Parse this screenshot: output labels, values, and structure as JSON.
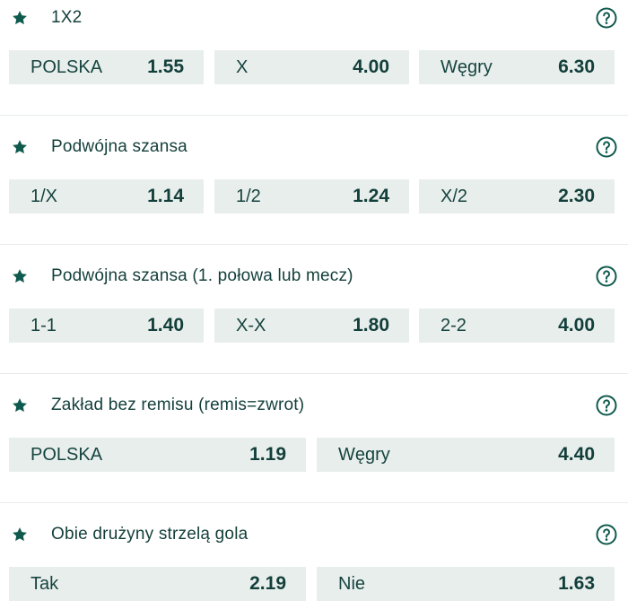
{
  "colors": {
    "accent": "#0f5a4e",
    "button_bg": "#e8eeec",
    "text": "#133f3a"
  },
  "icons": {
    "favorite": "star-icon",
    "help": "question-circle-icon"
  },
  "markets": [
    {
      "title": "1X2",
      "selections": [
        {
          "label": "POLSKA",
          "odds": "1.55"
        },
        {
          "label": "X",
          "odds": "4.00"
        },
        {
          "label": "Węgry",
          "odds": "6.30"
        }
      ]
    },
    {
      "title": "Podwójna szansa",
      "selections": [
        {
          "label": "1/X",
          "odds": "1.14"
        },
        {
          "label": "1/2",
          "odds": "1.24"
        },
        {
          "label": "X/2",
          "odds": "2.30"
        }
      ]
    },
    {
      "title": "Podwójna szansa (1. połowa lub mecz)",
      "selections": [
        {
          "label": "1-1",
          "odds": "1.40"
        },
        {
          "label": "X-X",
          "odds": "1.80"
        },
        {
          "label": "2-2",
          "odds": "4.00"
        }
      ]
    },
    {
      "title": "Zakład bez remisu (remis=zwrot)",
      "selections": [
        {
          "label": "POLSKA",
          "odds": "1.19"
        },
        {
          "label": "Węgry",
          "odds": "4.40"
        }
      ]
    },
    {
      "title": "Obie drużyny strzelą gola",
      "selections": [
        {
          "label": "Tak",
          "odds": "2.19"
        },
        {
          "label": "Nie",
          "odds": "1.63"
        }
      ]
    }
  ]
}
